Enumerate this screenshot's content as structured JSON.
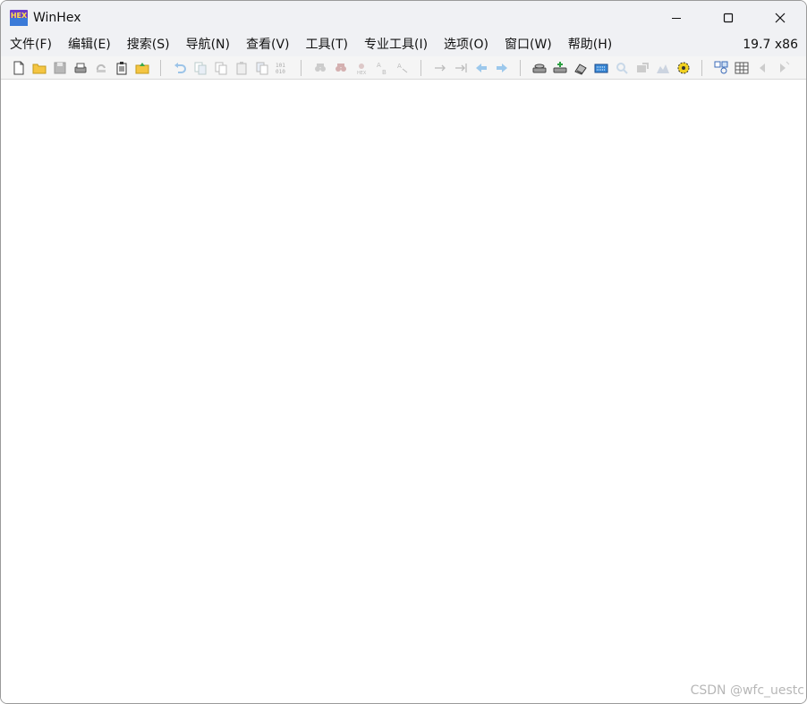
{
  "window": {
    "title": "WinHex",
    "app_icon_text": "HEX"
  },
  "menu": {
    "items": [
      "文件(F)",
      "编辑(E)",
      "搜索(S)",
      "导航(N)",
      "查看(V)",
      "工具(T)",
      "专业工具(I)",
      "选项(O)",
      "窗口(W)",
      "帮助(H)"
    ],
    "version": "19.7 x86"
  },
  "toolbar": {
    "groups": [
      [
        "new-file-icon",
        "open-folder-icon",
        "save-icon",
        "save-as-icon",
        "reload-icon",
        "properties-icon",
        "export-icon"
      ],
      [
        "undo-icon",
        "cut-icon",
        "copy-icon",
        "paste-icon",
        "copy-block-icon",
        "binary-icon"
      ],
      [
        "find-text-icon",
        "find-hex-icon",
        "replace-text-icon",
        "replace-hex-icon",
        "find-next-icon"
      ],
      [
        "goto-offset-icon",
        "goto-sector-icon",
        "back-icon",
        "forward-icon"
      ],
      [
        "open-disk-icon",
        "clone-disk-icon",
        "open-memory-icon",
        "calculator-icon",
        "analyze-icon",
        "hash-icon",
        "chart-icon",
        "settings-icon"
      ],
      [
        "tools-icon",
        "grid-icon",
        "prev-icon",
        "next-icon"
      ]
    ]
  },
  "colors": {
    "titlebar": "#f0f1f4",
    "toolbar": "#f5f5f5",
    "workspace": "#ffffff",
    "accent_blue": "#5aa0e8",
    "folder_yellow": "#f4c542"
  },
  "watermark": "CSDN @wfc_uestc"
}
